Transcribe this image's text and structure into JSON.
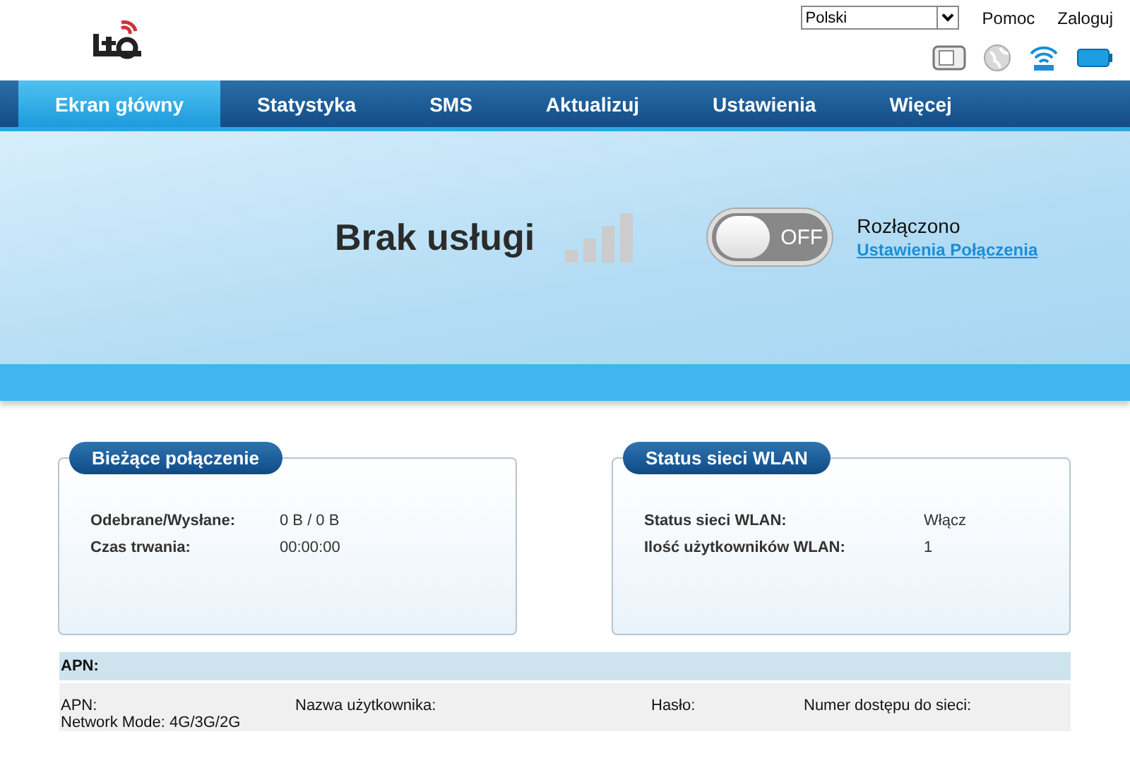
{
  "header": {
    "language": "Polski",
    "links": [
      "Pomoc",
      "Zaloguj"
    ]
  },
  "tabs": [
    {
      "label": "Ekran główny",
      "selected": true
    },
    {
      "label": "Statystyka",
      "selected": false
    },
    {
      "label": "SMS",
      "selected": false
    },
    {
      "label": "Aktualizuj",
      "selected": false
    },
    {
      "label": "Ustawienia",
      "selected": false
    },
    {
      "label": "Więcej",
      "selected": false
    }
  ],
  "status": {
    "network": "Brak usługi",
    "switch": {
      "label": "OFF",
      "on": false
    },
    "connection": "Rozłączono",
    "settings_link": "Ustawienia Połączenia"
  },
  "cards": [
    {
      "title": "Bieżące połączenie",
      "rows": [
        {
          "label": "Odebrane/Wysłane:",
          "value": "0 B /  0 B"
        },
        {
          "label": "Czas trwania:",
          "value": "00:00:00"
        }
      ]
    },
    {
      "title": "Status sieci WLAN",
      "rows": [
        {
          "label": "Status sieci WLAN:",
          "value": "Włącz"
        },
        {
          "label": "Ilość użytkowników WLAN:",
          "value": "1"
        }
      ]
    }
  ],
  "apn": {
    "title": "APN:",
    "fields": [
      "APN:",
      "Nazwa użytkownika:",
      "Hasło:",
      "Numer dostępu do sieci:"
    ],
    "network_mode": "Network Mode: 4G/3G/2G"
  }
}
